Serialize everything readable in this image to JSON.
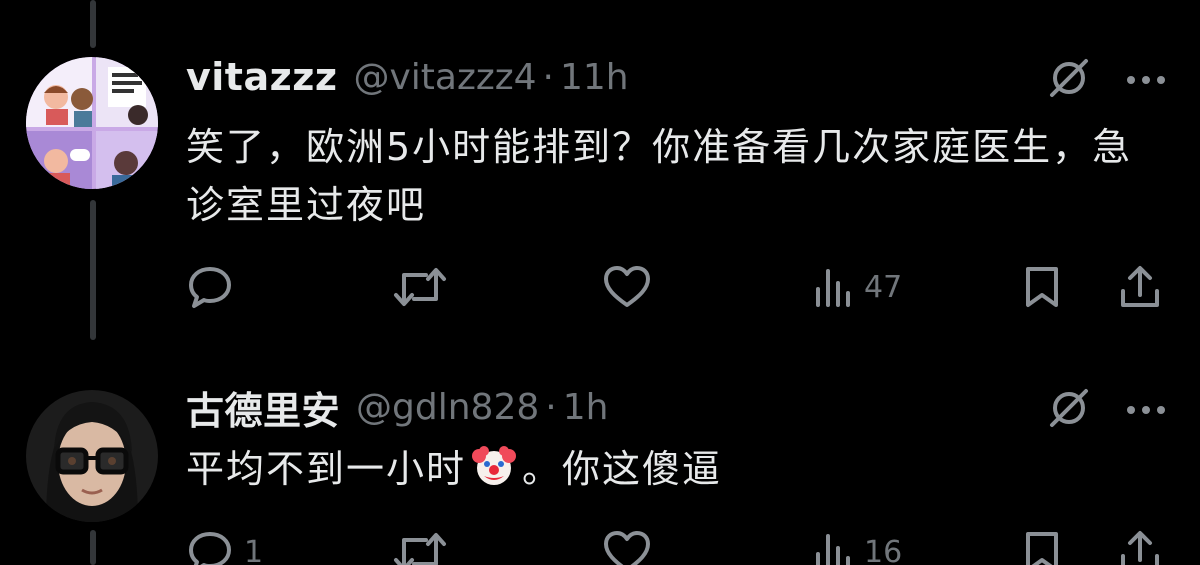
{
  "tweets": [
    {
      "display_name": "vitazzz",
      "handle": "@vitazzz4",
      "separator": "·",
      "time": "11h",
      "text": "笑了，欧洲5小时能排到？你准备看几次家庭医生，急诊室里过夜吧",
      "reply_count": "",
      "retweet_count": "",
      "like_count": "",
      "view_count": "47"
    },
    {
      "display_name": "古德里安",
      "handle": "@gdln828",
      "separator": "·",
      "time": "1h",
      "text_before_emoji": "平均不到一小时",
      "emoji": "🤡",
      "text_after_emoji": "。你这傻逼",
      "reply_count": "1",
      "retweet_count": "",
      "like_count": "",
      "view_count": "16"
    }
  ],
  "icons": {
    "grok": "grok-icon",
    "more": "more-icon",
    "reply": "reply-icon",
    "retweet": "retweet-icon",
    "like": "like-icon",
    "views": "views-icon",
    "bookmark": "bookmark-icon",
    "share": "share-icon"
  },
  "colors": {
    "background": "#000000",
    "primary_text": "#e7e9ea",
    "secondary_text": "#71767b",
    "thread_line": "#333639"
  }
}
